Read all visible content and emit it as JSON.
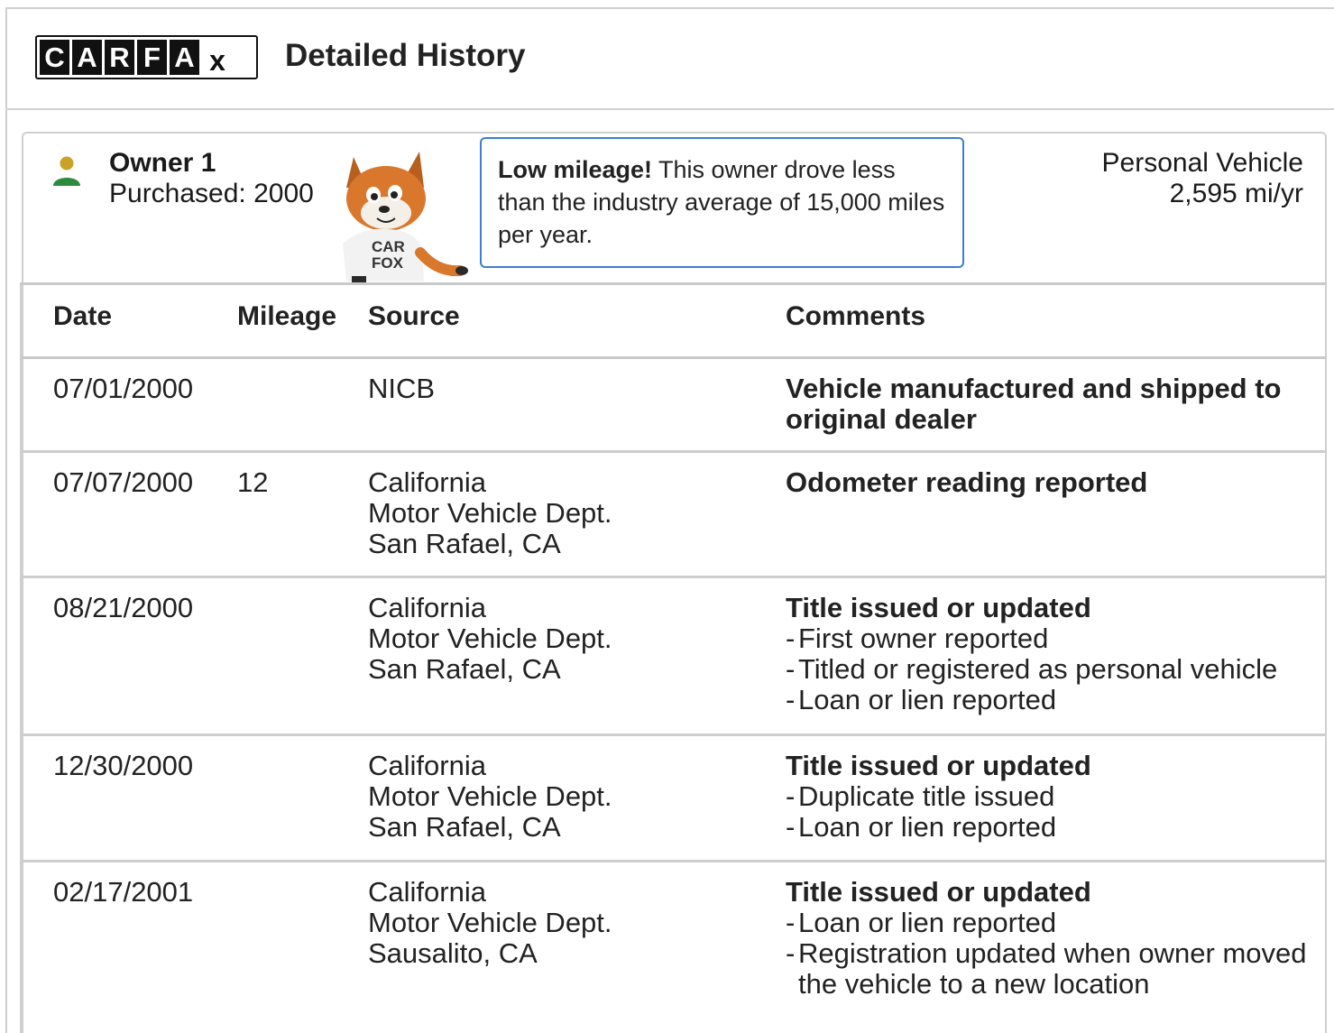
{
  "header": {
    "logo_letters": [
      "C",
      "A",
      "R",
      "F",
      "A",
      "x"
    ],
    "title": "Detailed History"
  },
  "owner": {
    "icon": "person-icon",
    "title": "Owner 1",
    "purchased": "Purchased: 2000",
    "mascot_text": "CAR FOX"
  },
  "callout": {
    "bold": "Low mileage!",
    "text": "This owner drove less than the industry average of 15,000 miles per year."
  },
  "vehicle": {
    "type": "Personal Vehicle",
    "rate": "2,595 mi/yr"
  },
  "table": {
    "headers": {
      "date": "Date",
      "mileage": "Mileage",
      "source": "Source",
      "comments": "Comments"
    },
    "rows": [
      {
        "date": "07/01/2000",
        "mileage": "",
        "source": [
          "NICB"
        ],
        "comment_title": "Vehicle manufactured and shipped to original dealer",
        "comment_items": []
      },
      {
        "date": "07/07/2000",
        "mileage": "12",
        "source": [
          "California",
          "Motor Vehicle Dept.",
          "San Rafael, CA"
        ],
        "comment_title": "Odometer reading reported",
        "comment_items": []
      },
      {
        "date": "08/21/2000",
        "mileage": "",
        "source": [
          "California",
          "Motor Vehicle Dept.",
          "San Rafael, CA"
        ],
        "comment_title": "Title issued or updated",
        "comment_items": [
          "First owner reported",
          "Titled or registered as personal vehicle",
          "Loan or lien reported"
        ]
      },
      {
        "date": "12/30/2000",
        "mileage": "",
        "source": [
          "California",
          "Motor Vehicle Dept.",
          "San Rafael, CA"
        ],
        "comment_title": "Title issued or updated",
        "comment_items": [
          "Duplicate title issued",
          "Loan or lien reported"
        ]
      },
      {
        "date": "02/17/2001",
        "mileage": "",
        "source": [
          "California",
          "Motor Vehicle Dept.",
          "Sausalito, CA"
        ],
        "comment_title": "Title issued or updated",
        "comment_items": [
          "Loan or lien reported",
          "Registration updated when owner moved the vehicle to a new location"
        ]
      }
    ]
  },
  "colors": {
    "owner_icon_head": "#c9a227",
    "owner_icon_body": "#2e8b3e",
    "callout_border": "#3a7fd0",
    "fox": "#d9782d"
  }
}
